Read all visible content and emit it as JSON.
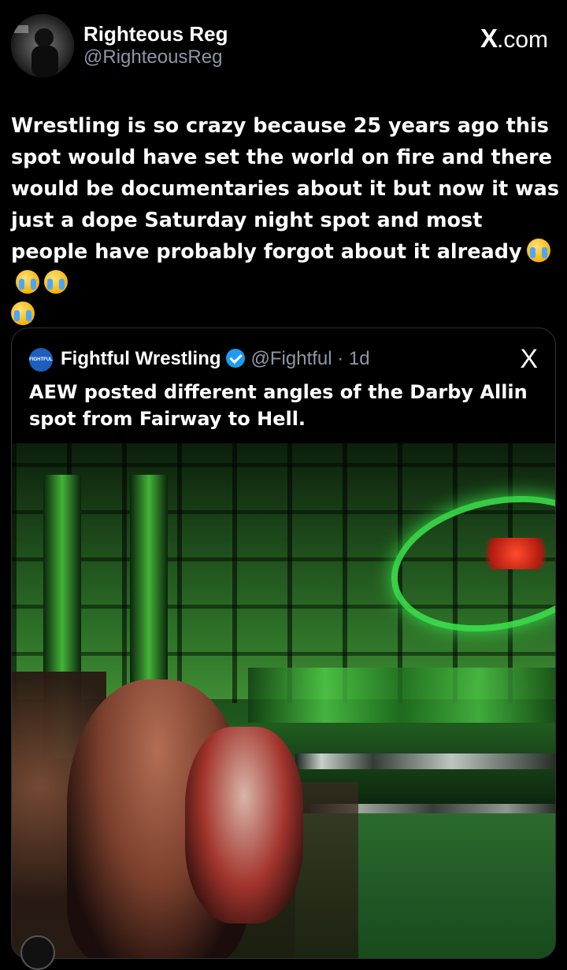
{
  "post": {
    "display_name": "Righteous Reg",
    "handle": "@RighteousReg",
    "site_label": "com",
    "site_logo": "X",
    "text": "Wrestling is so crazy because 25 years ago this spot would have set the world on fire and there would be documentaries about it but now it was just a dope Saturday night spot and most people have probably forgot about it already",
    "emoji": [
      "loudly-crying-face",
      "loudly-crying-face",
      "loudly-crying-face",
      "loudly-crying-face"
    ]
  },
  "quote": {
    "logo_text": "FIGHTFUL",
    "display_name": "Fightful Wrestling",
    "handle_time": "@Fightful · 1d",
    "x_mark": "X",
    "text": "AEW posted different angles of the Darby Allin spot from Fairway to Hell."
  },
  "colors": {
    "background": "#000000",
    "text": "#ffffff",
    "secondary_text": "#8b98a5",
    "verified": "#1d9bf0",
    "border": "#333333"
  }
}
